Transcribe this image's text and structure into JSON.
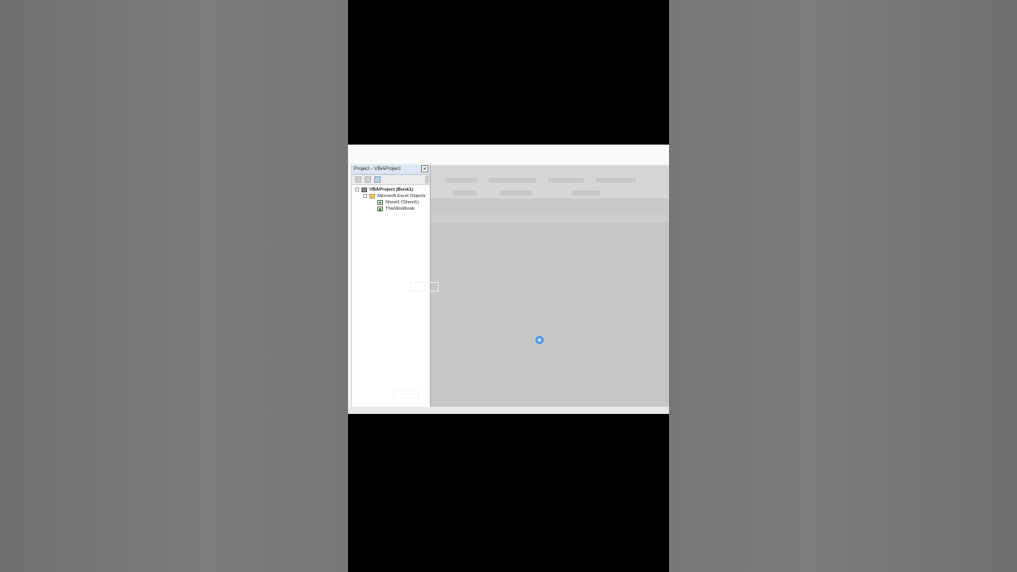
{
  "project_explorer": {
    "title": "Project - VBAProject",
    "close_label": "×",
    "tree": {
      "project": "VBAProject (Book1)",
      "folder": "Microsoft Excel Objects",
      "sheet": "Sheet1 (Sheet1)",
      "workbook": "ThisWorkbook"
    }
  },
  "icons": {
    "close": "close-icon",
    "project": "vba-project-icon",
    "folder": "folder-icon",
    "sheet": "worksheet-icon",
    "workbook": "workbook-icon",
    "cursor": "mouse-cursor-icon"
  },
  "colors": {
    "cursor": "#5aa6ee",
    "project_title_bar": "#dde6f2"
  }
}
